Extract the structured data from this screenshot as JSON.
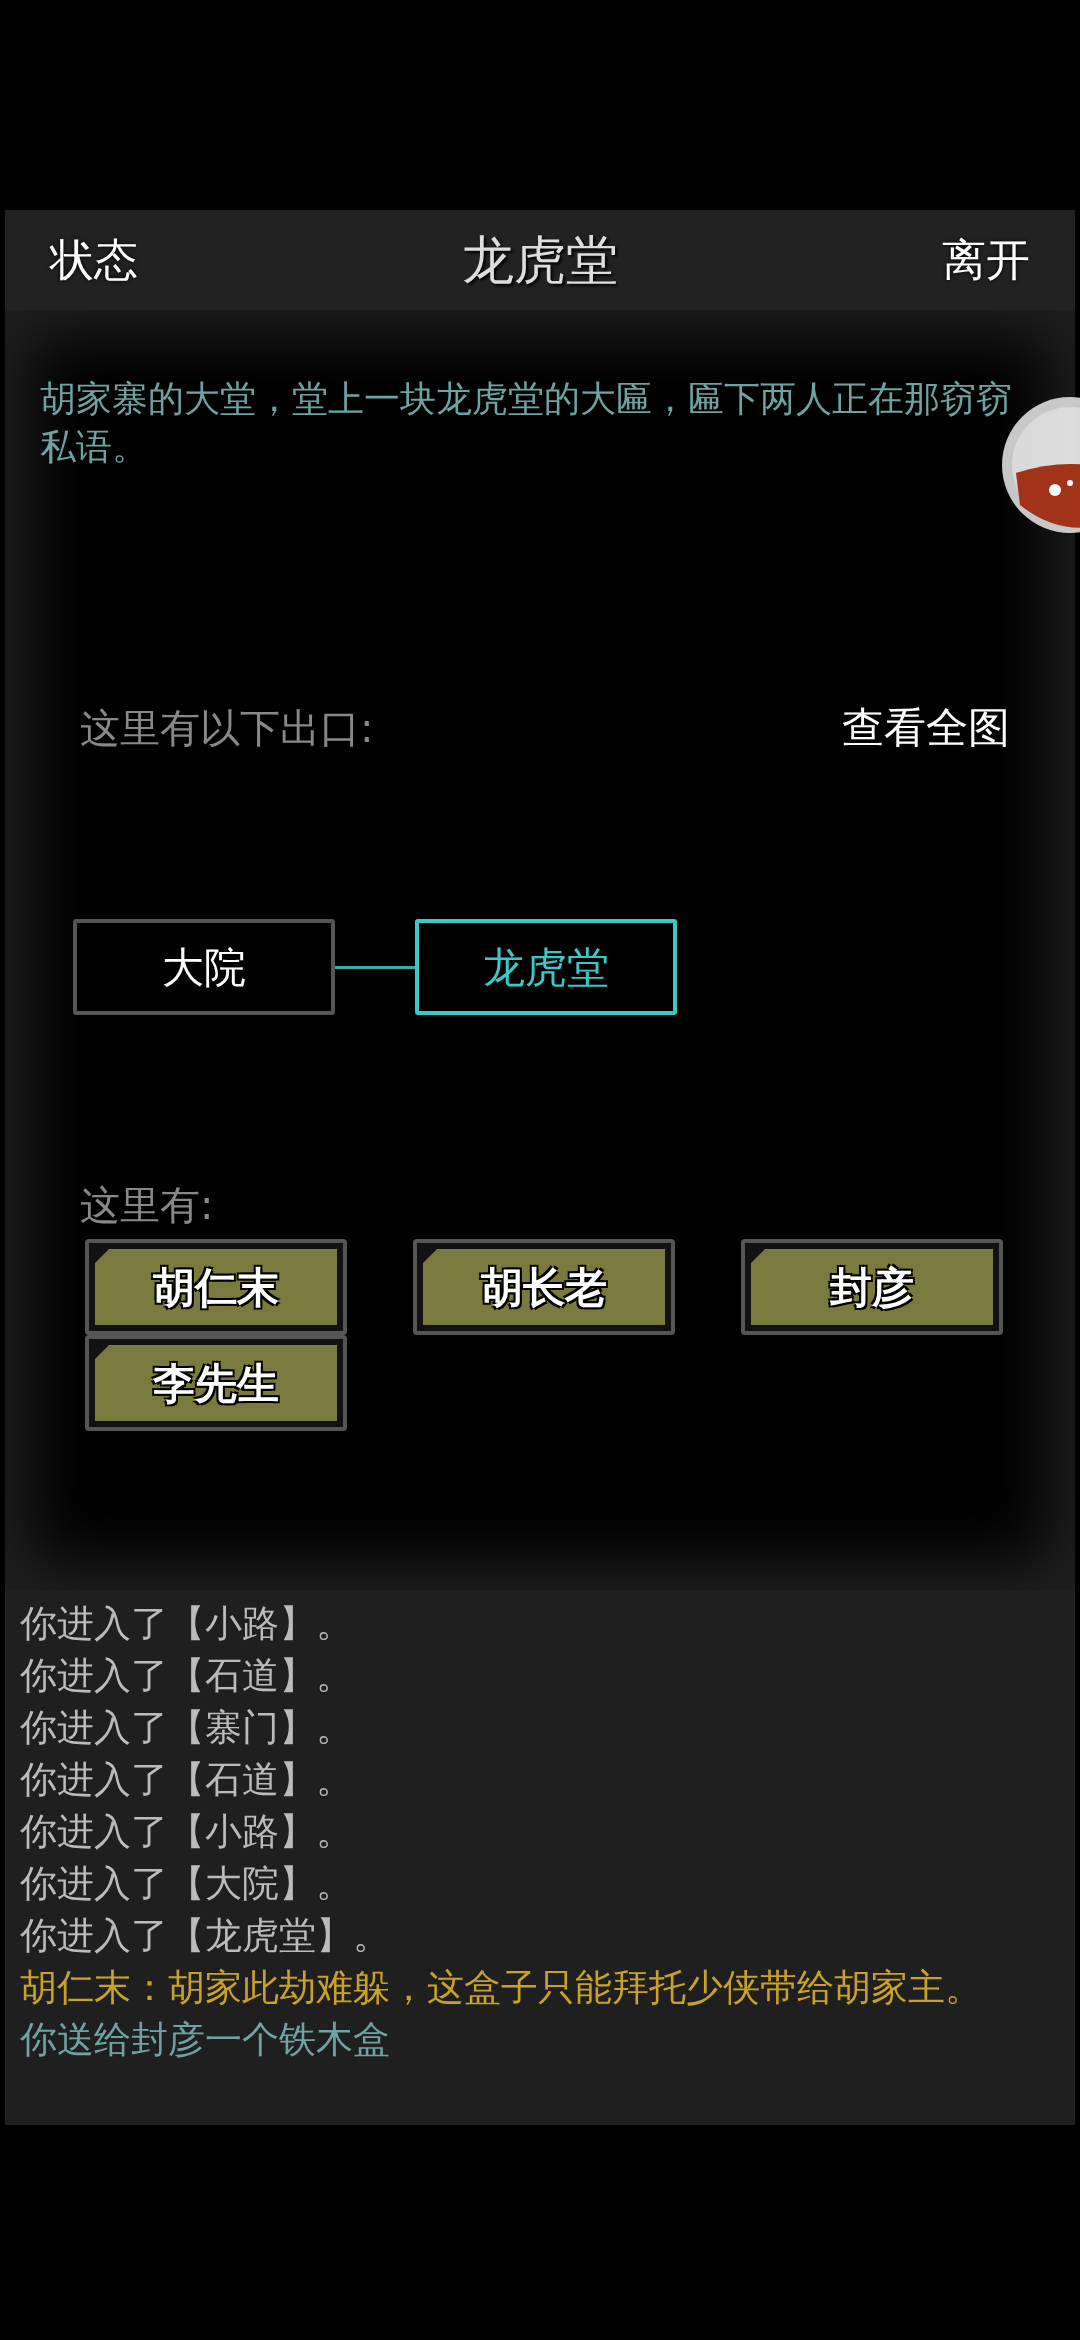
{
  "header": {
    "left_button": "状态",
    "title": "龙虎堂",
    "right_button": "离开"
  },
  "description": "胡家寨的大堂，堂上一块龙虎堂的大匾，匾下两人正在那窃窃私语。",
  "exits": {
    "label": "这里有以下出口:",
    "map_button": "查看全图",
    "nodes": [
      {
        "label": "大院",
        "selected": false
      },
      {
        "label": "龙虎堂",
        "selected": true
      }
    ]
  },
  "people": {
    "label": "这里有:",
    "items": [
      "胡仁末",
      "胡长老",
      "封彦",
      "李先生"
    ]
  },
  "log": [
    {
      "kind": "system",
      "text": "你进入了【小路】。"
    },
    {
      "kind": "system",
      "text": "你进入了【石道】。"
    },
    {
      "kind": "system",
      "text": "你进入了【寨门】。"
    },
    {
      "kind": "system",
      "text": "你进入了【石道】。"
    },
    {
      "kind": "system",
      "text": "你进入了【小路】。"
    },
    {
      "kind": "system",
      "text": "你进入了【大院】。"
    },
    {
      "kind": "system",
      "text": "你进入了【龙虎堂】。"
    },
    {
      "kind": "speech",
      "text": "胡仁末：胡家此劫难躲，这盒子只能拜托少侠带给胡家主。"
    },
    {
      "kind": "action",
      "text": "你送给封彦一个铁木盒"
    }
  ]
}
